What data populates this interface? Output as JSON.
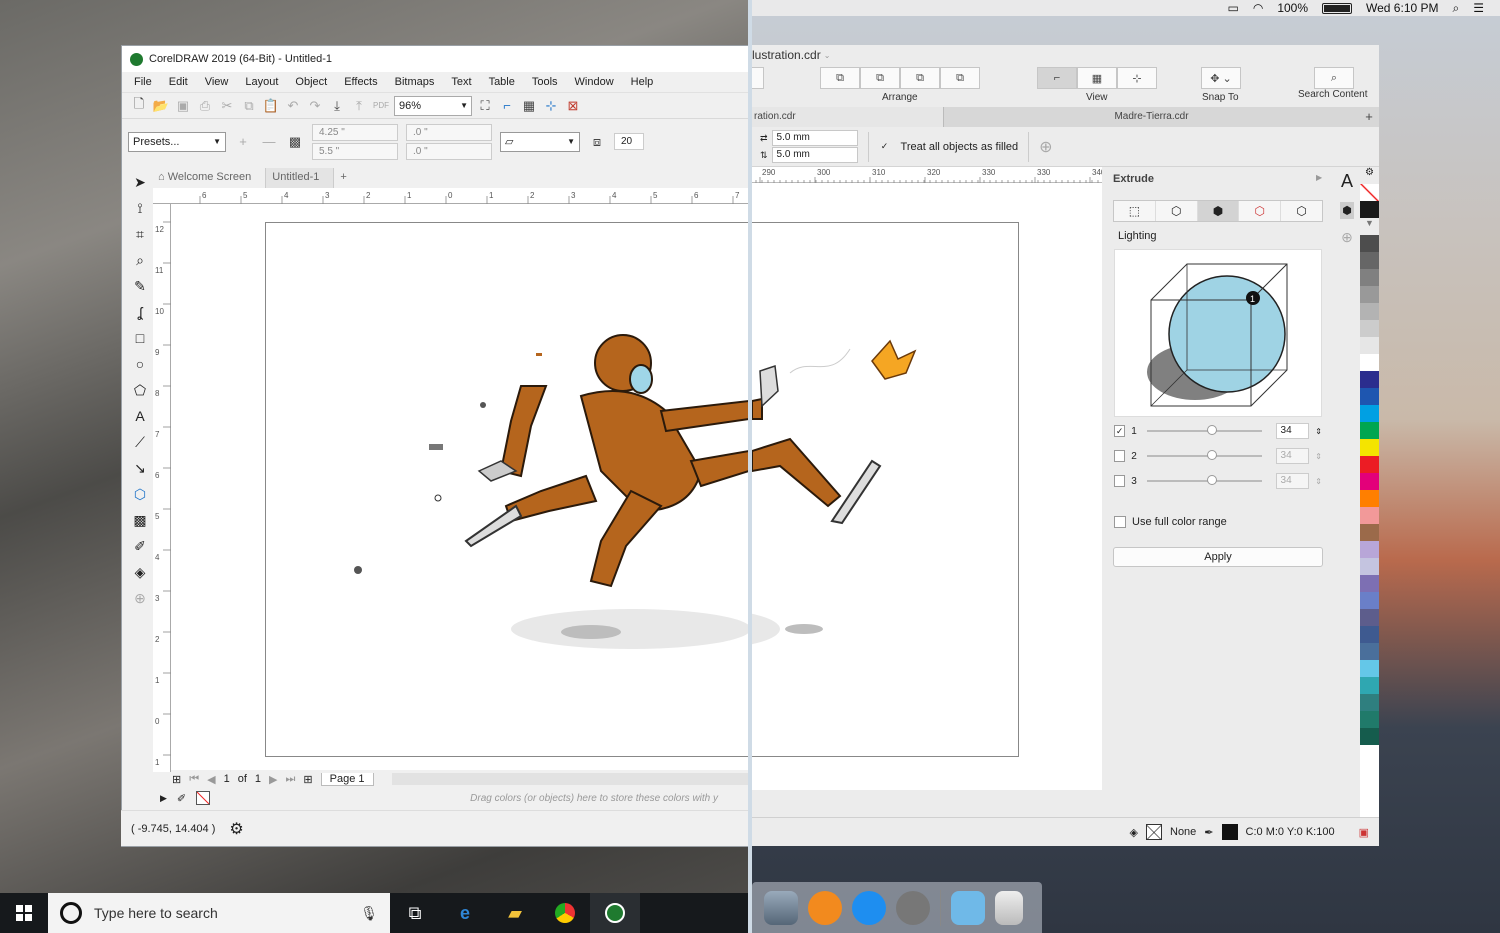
{
  "mac_menubar": {
    "battery": "100%",
    "clock": "Wed 6:10 PM"
  },
  "win": {
    "title": "CorelDRAW 2019 (64-Bit) - Untitled-1",
    "menu": [
      "File",
      "Edit",
      "View",
      "Layout",
      "Object",
      "Effects",
      "Bitmaps",
      "Text",
      "Table",
      "Tools",
      "Window",
      "Help"
    ],
    "zoom": "96%",
    "presets": "Presets...",
    "width_field": "4.25 \"",
    "height_field": "5.5 \"",
    "nudge_x": ".0 \"",
    "nudge_y": ".0 \"",
    "duplicate_distance": "20",
    "tabs": [
      "Welcome Screen",
      "Untitled-1"
    ],
    "page_nav": {
      "current": "1",
      "of_label": "of",
      "total": "1",
      "page_tab": "Page 1"
    },
    "drag_hint": "Drag colors (or objects) here to store these colors with y",
    "cursor_position": "( -9.745, 14.404 )",
    "ruler_top": [
      "6",
      "5",
      "4",
      "3",
      "2",
      "1",
      "0",
      "1",
      "2",
      "3",
      "4",
      "5",
      "6",
      "7"
    ],
    "ruler_left": [
      "12",
      "11",
      "10",
      "9",
      "8",
      "7",
      "6",
      "5",
      "4",
      "3",
      "2",
      "1",
      "0",
      "1"
    ]
  },
  "taskbar": {
    "search_placeholder": "Type here to search"
  },
  "mac": {
    "title": "lustration.cdr",
    "toolbar": {
      "arrange": "Arrange",
      "view": "View",
      "snap_to": "Snap To",
      "search": "Search Content"
    },
    "tabs": [
      "ration.cdr",
      "Madre-Tierra.cdr"
    ],
    "offset_x": "5.0 mm",
    "offset_y": "5.0 mm",
    "treat_filled": "Treat all objects as filled",
    "ruler": [
      "290",
      "300",
      "310",
      "320",
      "330",
      "330",
      "340"
    ],
    "docker": {
      "title": "Extrude",
      "lighting": "Lighting",
      "lights": [
        {
          "id": "1",
          "value": "34",
          "checked": "✓"
        },
        {
          "id": "2",
          "value": "34",
          "checked": ""
        },
        {
          "id": "3",
          "value": "34",
          "checked": ""
        }
      ],
      "full_range": "Use full color range",
      "apply": "Apply"
    },
    "status": {
      "fill": "None",
      "color": "C:0 M:0 Y:0 K:100"
    },
    "palette": [
      "#1a1a1a",
      "#333333",
      "#4d4d4d",
      "#666666",
      "#808080",
      "#999999",
      "#b3b3b3",
      "#cccccc",
      "#e6e6e6",
      "#ffffff",
      "#2b2d8e",
      "#1e56b0",
      "#00a0e3",
      "#00a650",
      "#f4e400",
      "#ec1c24",
      "#e3007a",
      "#ff7f00",
      "#f29999",
      "#9b6a4a",
      "#b8a6d8",
      "#c4c4e0",
      "#7d6fb3",
      "#6a7fc8",
      "#5d5d8c",
      "#3e5a90",
      "#4a6f9b",
      "#64c7e8",
      "#2fa7b1",
      "#2f7f7f",
      "#207a6a",
      "#155c4d"
    ]
  }
}
